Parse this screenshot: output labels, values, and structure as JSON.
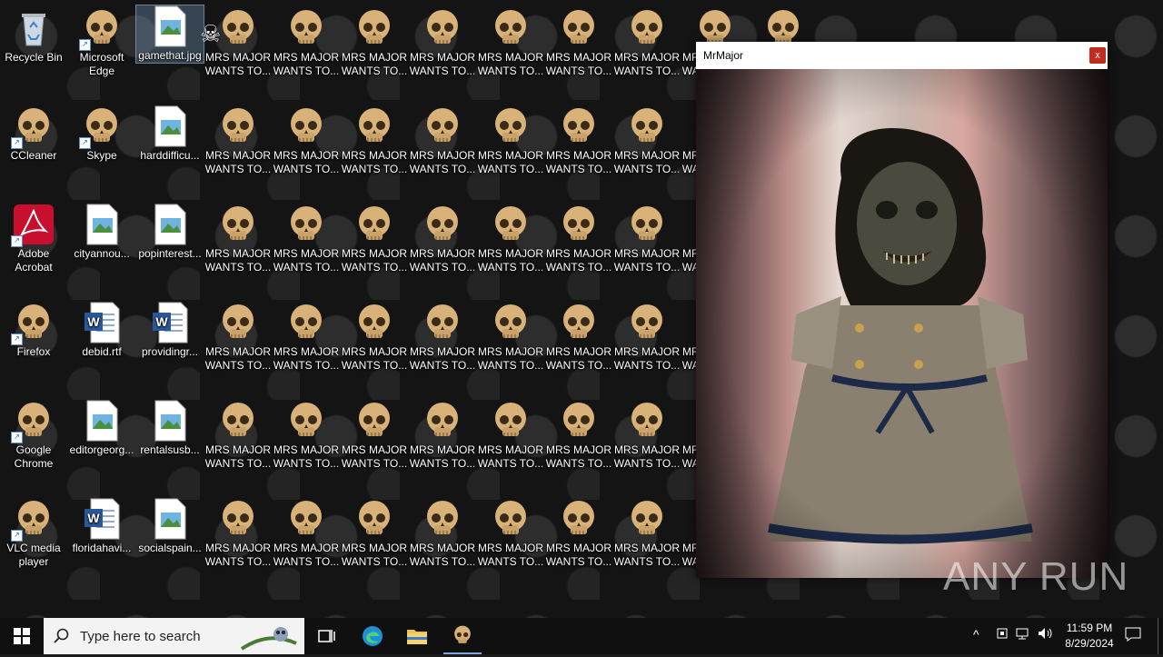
{
  "desktop": {
    "icons": {
      "recycle_bin": "Recycle Bin",
      "edge": "Microsoft\nEdge",
      "gamethat": "gamethat.jpg",
      "ccleaner": "CCleaner",
      "skype": "Skype",
      "harddifficu": "harddifficu...",
      "acrobat": "Adobe\nAcrobat",
      "cityannou": "cityannou...",
      "popinterest": "popinterest...",
      "firefox": "Firefox",
      "debid": "debid.rtf",
      "providingr": "providingr...",
      "chrome": "Google\nChrome",
      "editorgeorg": "editorgeorg...",
      "rentalsusb": "rentalsusb...",
      "vlc": "VLC media\nplayer",
      "floridahavi": "floridahavi...",
      "socialspain": "socialspain..."
    },
    "skull_label": "MRS MAJOR\nWANTS TO..."
  },
  "window": {
    "title": "MrMajor",
    "close_label": "x"
  },
  "watermark": "ANY RUN",
  "taskbar": {
    "search_placeholder": "Type here to search",
    "time": "11:59 PM",
    "date": "8/29/2024"
  },
  "colors": {
    "taskbar": "#101010",
    "close": "#c42b1c",
    "search_bg": "#f3f3f3"
  }
}
